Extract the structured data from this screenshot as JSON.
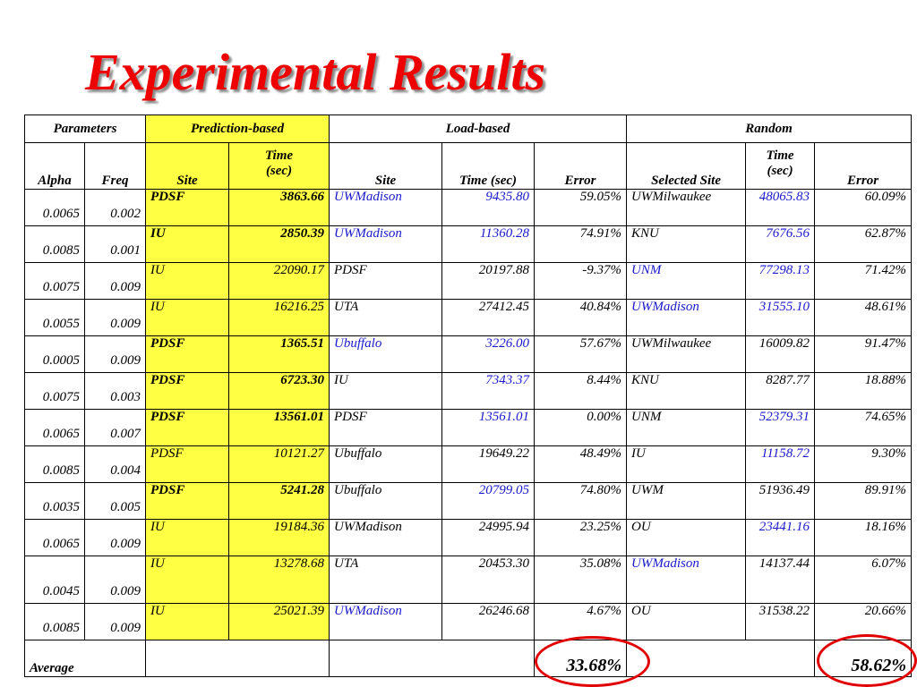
{
  "title": "Experimental Results",
  "headers": {
    "parameters": "Parameters",
    "prediction_based": "Prediction-based",
    "load_based": "Load-based",
    "random": "Random",
    "alpha": "Alpha",
    "freq": "Freq",
    "site": "Site",
    "time_sec_line1": "Time",
    "time_sec_line2": "(sec)",
    "time_sec": "Time (sec)",
    "error": "Error",
    "selected_site": "Selected Site"
  },
  "colors": {
    "title": "#ee0000",
    "highlight": "#ffff44",
    "blue_text": "#1a1acc",
    "circle": "#e00000"
  },
  "rows": [
    {
      "alpha": "0.0065",
      "freq": "0.002",
      "pred_site": "PDSF",
      "pred_time": "3863.66",
      "pred_bold": true,
      "load_site": "UWMadison",
      "load_site_blue": true,
      "load_time": "9435.80",
      "load_time_blue": true,
      "load_error": "59.05%",
      "rand_site": "UWMilwaukee",
      "rand_site_blue": false,
      "rand_time": "48065.83",
      "rand_time_blue": true,
      "rand_error": "60.09%"
    },
    {
      "alpha": "0.0085",
      "freq": "0.001",
      "pred_site": "IU",
      "pred_time": "2850.39",
      "pred_bold": true,
      "load_site": "UWMadison",
      "load_site_blue": true,
      "load_time": "11360.28",
      "load_time_blue": true,
      "load_error": "74.91%",
      "rand_site": "KNU",
      "rand_site_blue": false,
      "rand_time": "7676.56",
      "rand_time_blue": true,
      "rand_error": "62.87%"
    },
    {
      "alpha": "0.0075",
      "freq": "0.009",
      "pred_site": "IU",
      "pred_time": "22090.17",
      "pred_bold": false,
      "load_site": "PDSF",
      "load_site_blue": false,
      "load_time": "20197.88",
      "load_time_blue": false,
      "load_error": "-9.37%",
      "rand_site": "UNM",
      "rand_site_blue": true,
      "rand_time": "77298.13",
      "rand_time_blue": true,
      "rand_error": "71.42%"
    },
    {
      "alpha": "0.0055",
      "freq": "0.009",
      "pred_site": "IU",
      "pred_time": "16216.25",
      "pred_bold": false,
      "load_site": "UTA",
      "load_site_blue": false,
      "load_time": "27412.45",
      "load_time_blue": false,
      "load_error": "40.84%",
      "rand_site": "UWMadison",
      "rand_site_blue": true,
      "rand_time": "31555.10",
      "rand_time_blue": true,
      "rand_error": "48.61%"
    },
    {
      "alpha": "0.0005",
      "freq": "0.009",
      "pred_site": "PDSF",
      "pred_time": "1365.51",
      "pred_bold": true,
      "load_site": "Ubuffalo",
      "load_site_blue": true,
      "load_time": "3226.00",
      "load_time_blue": true,
      "load_error": "57.67%",
      "rand_site": "UWMilwaukee",
      "rand_site_blue": false,
      "rand_time": "16009.82",
      "rand_time_blue": false,
      "rand_error": "91.47%"
    },
    {
      "alpha": "0.0075",
      "freq": "0.003",
      "pred_site": "PDSF",
      "pred_time": "6723.30",
      "pred_bold": true,
      "load_site": "IU",
      "load_site_blue": false,
      "load_time": "7343.37",
      "load_time_blue": true,
      "load_error": "8.44%",
      "rand_site": "KNU",
      "rand_site_blue": false,
      "rand_time": "8287.77",
      "rand_time_blue": false,
      "rand_error": "18.88%"
    },
    {
      "alpha": "0.0065",
      "freq": "0.007",
      "pred_site": "PDSF",
      "pred_time": "13561.01",
      "pred_bold": true,
      "load_site": "PDSF",
      "load_site_blue": false,
      "load_time": "13561.01",
      "load_time_blue": true,
      "load_error": "0.00%",
      "rand_site": "UNM",
      "rand_site_blue": false,
      "rand_time": "52379.31",
      "rand_time_blue": true,
      "rand_error": "74.65%"
    },
    {
      "alpha": "0.0085",
      "freq": "0.004",
      "pred_site": "PDSF",
      "pred_time": "10121.27",
      "pred_bold": false,
      "load_site": "Ubuffalo",
      "load_site_blue": false,
      "load_time": "19649.22",
      "load_time_blue": false,
      "load_error": "48.49%",
      "rand_site": "IU",
      "rand_site_blue": false,
      "rand_time": "11158.72",
      "rand_time_blue": true,
      "rand_error": "9.30%"
    },
    {
      "alpha": "0.0035",
      "freq": "0.005",
      "pred_site": "PDSF",
      "pred_time": "5241.28",
      "pred_bold": true,
      "load_site": "Ubuffalo",
      "load_site_blue": false,
      "load_time": "20799.05",
      "load_time_blue": true,
      "load_error": "74.80%",
      "rand_site": "UWM",
      "rand_site_blue": false,
      "rand_time": "51936.49",
      "rand_time_blue": false,
      "rand_error": "89.91%"
    },
    {
      "alpha": "0.0065",
      "freq": "0.009",
      "pred_site": "IU",
      "pred_time": "19184.36",
      "pred_bold": false,
      "load_site": "UWMadison",
      "load_site_blue": false,
      "load_time": "24995.94",
      "load_time_blue": false,
      "load_error": "23.25%",
      "rand_site": "OU",
      "rand_site_blue": false,
      "rand_time": "23441.16",
      "rand_time_blue": true,
      "rand_error": "18.16%"
    },
    {
      "alpha": "0.0045",
      "freq": "0.009",
      "pred_site": "IU",
      "pred_time": "13278.68",
      "pred_bold": false,
      "load_site": "UTA",
      "load_site_blue": false,
      "load_time": "20453.30",
      "load_time_blue": false,
      "load_error": "35.08%",
      "rand_site": "UWMadison",
      "rand_site_blue": true,
      "rand_time": "14137.44",
      "rand_time_blue": false,
      "rand_error": "6.07%"
    },
    {
      "alpha": "0.0085",
      "freq": "0.009",
      "pred_site": "IU",
      "pred_time": "25021.39",
      "pred_bold": false,
      "load_site": "UWMadison",
      "load_site_blue": true,
      "load_time": "26246.68",
      "load_time_blue": false,
      "load_error": "4.67%",
      "rand_site": "OU",
      "rand_site_blue": false,
      "rand_time": "31538.22",
      "rand_time_blue": false,
      "rand_error": "20.66%"
    }
  ],
  "average": {
    "label": "Average",
    "load_error": "33.68%",
    "random_error": "58.62%"
  }
}
